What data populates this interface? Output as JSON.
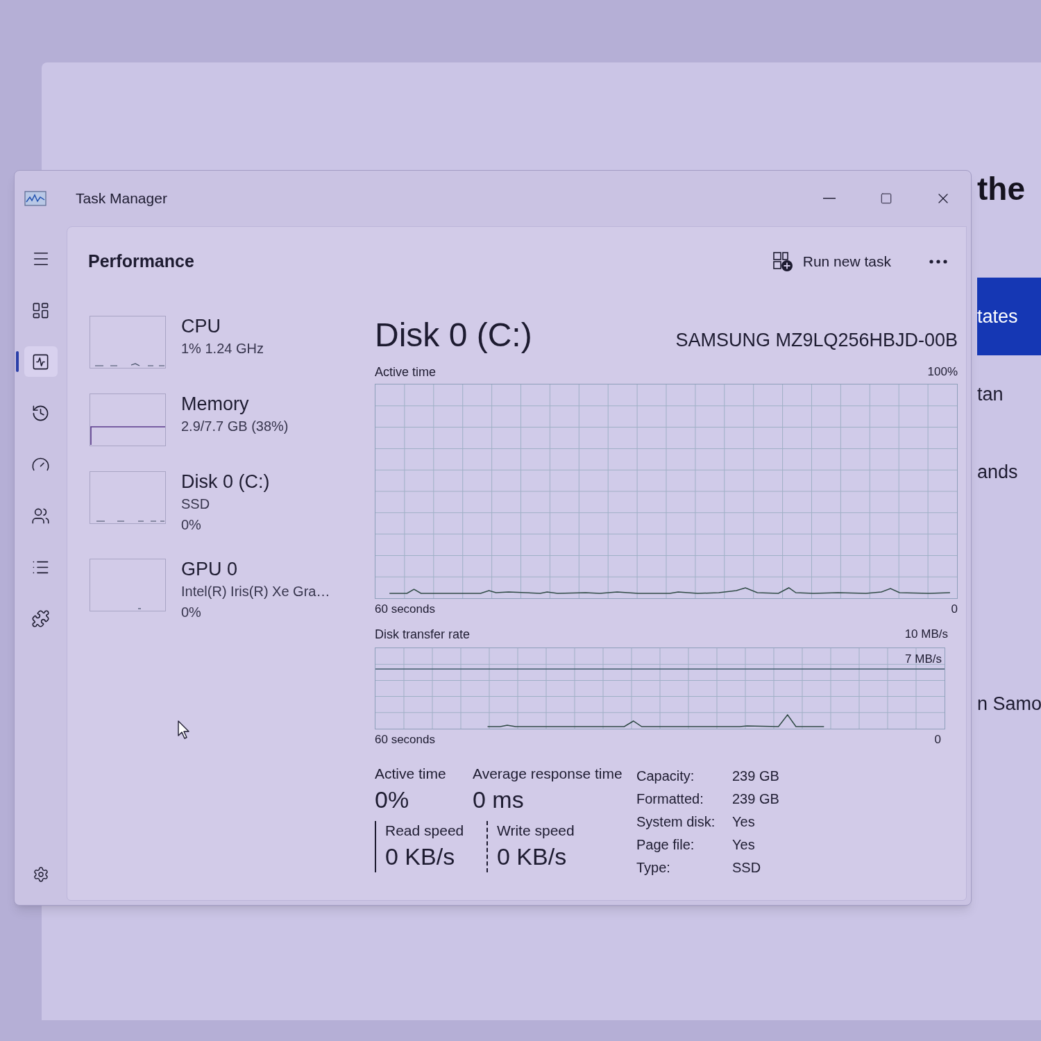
{
  "background_window": {
    "heading": "the",
    "rows": [
      {
        "text": "tates",
        "selected": true
      },
      {
        "text": "tan",
        "selected": false
      },
      {
        "text": "ands",
        "selected": false
      },
      {
        "text": "n Samo",
        "selected": false
      }
    ]
  },
  "window": {
    "title": "Task Manager"
  },
  "nav": {
    "items": [
      {
        "selected": false
      },
      {
        "selected": true
      },
      {
        "selected": false
      },
      {
        "selected": false
      },
      {
        "selected": false
      },
      {
        "selected": false
      },
      {
        "selected": false
      }
    ]
  },
  "header": {
    "title": "Performance",
    "action": "Run new task"
  },
  "devices": [
    {
      "name": "CPU",
      "details": [
        "1% 1.24 GHz"
      ]
    },
    {
      "name": "Memory",
      "details": [
        "2.9/7.7 GB (38%)"
      ]
    },
    {
      "name": "Disk 0 (C:)",
      "details": [
        "SSD",
        "0%"
      ]
    },
    {
      "name": "GPU 0",
      "details": [
        "Intel(R) Iris(R) Xe Gra…",
        "0%"
      ]
    }
  ],
  "disk": {
    "title": "Disk 0 (C:)",
    "model": "SAMSUNG MZ9LQ256HBJD-00B",
    "active_graph": {
      "label": "Active time",
      "max": "100%",
      "span": "60 seconds",
      "min": "0"
    },
    "transfer_graph": {
      "label": "Disk transfer rate",
      "max": "10 MB/s",
      "reference": "7 MB/s",
      "span": "60 seconds",
      "min": "0"
    },
    "stats": [
      {
        "label": "Active time",
        "value": "0%"
      },
      {
        "label": "Average response time",
        "value": "0 ms"
      }
    ],
    "speeds": [
      {
        "label": "Read speed",
        "value": "0 KB/s",
        "kind": "solid"
      },
      {
        "label": "Write speed",
        "value": "0 KB/s",
        "kind": "dashed"
      }
    ],
    "properties": [
      {
        "label": "Capacity:",
        "value": "239 GB"
      },
      {
        "label": "Formatted:",
        "value": "239 GB"
      },
      {
        "label": "System disk:",
        "value": "Yes"
      },
      {
        "label": "Page file:",
        "value": "Yes"
      },
      {
        "label": "Type:",
        "value": "SSD"
      }
    ]
  }
}
